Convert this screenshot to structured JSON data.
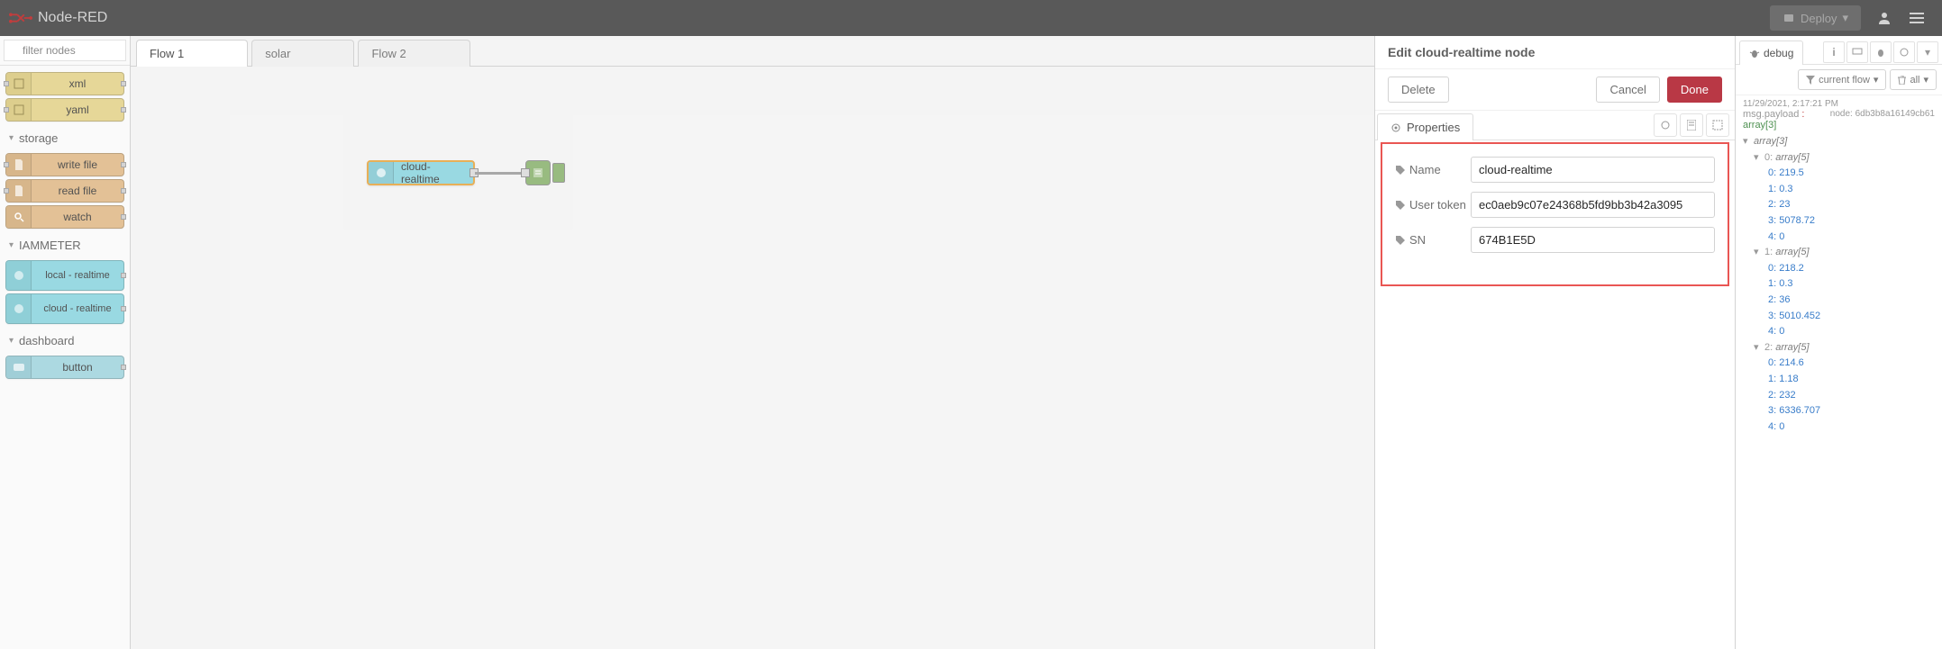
{
  "header": {
    "app_name": "Node-RED",
    "deploy_label": "Deploy"
  },
  "palette": {
    "filter_placeholder": "filter nodes",
    "nodes_top": [
      {
        "label": "xml"
      },
      {
        "label": "yaml"
      }
    ],
    "categories": [
      {
        "name": "storage",
        "nodes": [
          {
            "label": "write file"
          },
          {
            "label": "read file"
          },
          {
            "label": "watch"
          }
        ]
      },
      {
        "name": "IAMMETER",
        "nodes": [
          {
            "label": "local - realtime"
          },
          {
            "label": "cloud - realtime"
          }
        ]
      },
      {
        "name": "dashboard",
        "nodes": [
          {
            "label": "button"
          }
        ]
      }
    ]
  },
  "workspace": {
    "tabs": [
      {
        "label": "Flow 1",
        "active": true
      },
      {
        "label": "solar",
        "active": false
      },
      {
        "label": "Flow 2",
        "active": false
      }
    ],
    "cloud_node_label": "cloud-realtime"
  },
  "edit_panel": {
    "title": "Edit cloud-realtime node",
    "delete_label": "Delete",
    "cancel_label": "Cancel",
    "done_label": "Done",
    "properties_tab": "Properties",
    "fields": {
      "name_label": "Name",
      "name_value": "cloud-realtime",
      "token_label": "User token",
      "token_value": "ec0aeb9c07e24368b5fd9bb3b42a3095",
      "sn_label": "SN",
      "sn_value": "674B1E5D"
    }
  },
  "debug": {
    "tab_label": "debug",
    "filter_current": "current flow",
    "filter_all": "all",
    "msg_time": "11/29/2021, 2:17:21 PM",
    "msg_node": "node: 6db3b8a16149cb61",
    "msg_path": "msg.payload",
    "msg_type": "array[3]",
    "root_label": "array[3]",
    "arrays": [
      {
        "values": [
          219.5,
          0.3,
          23,
          5078.72,
          0
        ]
      },
      {
        "values": [
          218.2,
          0.3,
          36,
          5010.452,
          0
        ]
      },
      {
        "values": [
          214.6,
          1.18,
          232,
          6336.707,
          0
        ]
      }
    ]
  }
}
